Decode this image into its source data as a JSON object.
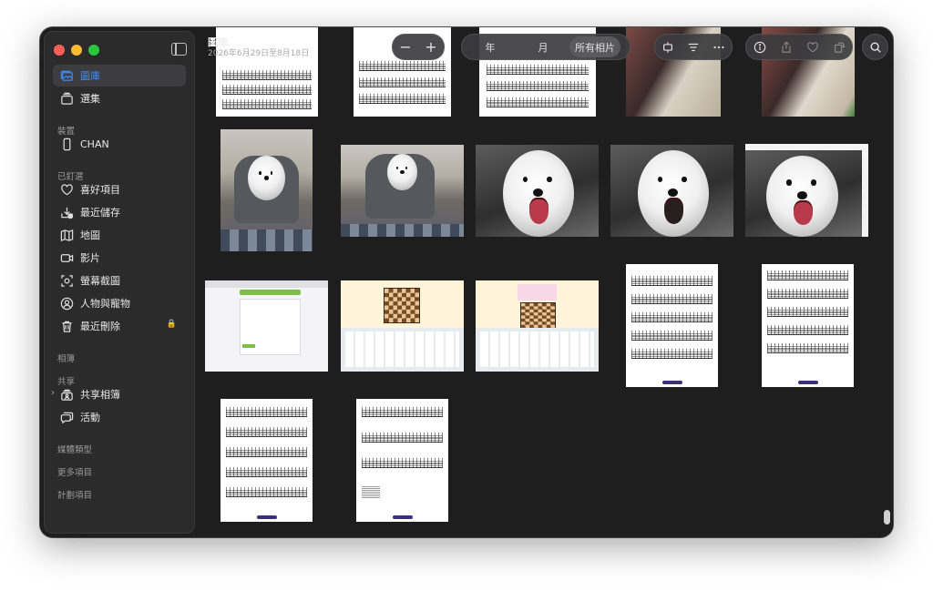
{
  "window": {
    "title": "圖庫",
    "subtitle": "2026年6月29日至8月18日"
  },
  "sidebar": {
    "top_items": [
      {
        "label": "圖庫",
        "icon": "photo-library-icon",
        "active": true
      },
      {
        "label": "選集",
        "icon": "collections-icon"
      }
    ],
    "sections": {
      "devices": "裝置",
      "pinned": "已釘選",
      "albums": "相簿",
      "shared": "共享",
      "media_types": "媒體類型",
      "utilities": "更多項目",
      "projects": "計劃項目"
    },
    "device_items": [
      {
        "label": "CHAN",
        "icon": "iphone-icon"
      }
    ],
    "pinned_items": [
      {
        "label": "喜好項目",
        "icon": "heart-icon"
      },
      {
        "label": "最近儲存",
        "icon": "recently-saved-icon"
      },
      {
        "label": "地圖",
        "icon": "map-icon"
      },
      {
        "label": "影片",
        "icon": "video-icon"
      },
      {
        "label": "螢幕截圖",
        "icon": "screenshot-icon"
      },
      {
        "label": "人物與寵物",
        "icon": "people-icon"
      },
      {
        "label": "最近刪除",
        "icon": "trash-icon"
      }
    ],
    "shared_items": [
      {
        "label": "共享相簿",
        "icon": "shared-album-icon"
      },
      {
        "label": "活動",
        "icon": "activity-icon"
      }
    ]
  },
  "toolbar": {
    "zoom_out": "−",
    "zoom_in": "+",
    "segments": [
      "年",
      "月",
      "所有相片"
    ],
    "active_segment": "所有相片",
    "icons": [
      "slideshow-icon",
      "filter-icon",
      "more-icon",
      "info-icon",
      "share-icon",
      "favorite-icon",
      "rotate-icon",
      "search-icon"
    ]
  },
  "photos": [
    {
      "kind": "sheet"
    },
    {
      "kind": "sheet"
    },
    {
      "kind": "sheet"
    },
    {
      "kind": "photo"
    },
    {
      "kind": "photo"
    },
    {
      "kind": "dog-room"
    },
    {
      "kind": "dog-room"
    },
    {
      "kind": "dog"
    },
    {
      "kind": "dog"
    },
    {
      "kind": "dog-screenshot"
    },
    {
      "kind": "web-screenshot"
    },
    {
      "kind": "chess"
    },
    {
      "kind": "chess"
    },
    {
      "kind": "sheet"
    },
    {
      "kind": "sheet"
    },
    {
      "kind": "sheet"
    },
    {
      "kind": "sheet"
    }
  ],
  "colors": {
    "accent": "#3f8cff",
    "window_bg": "#1e1e1e",
    "sidebar_bg": "#2b2b2b"
  }
}
